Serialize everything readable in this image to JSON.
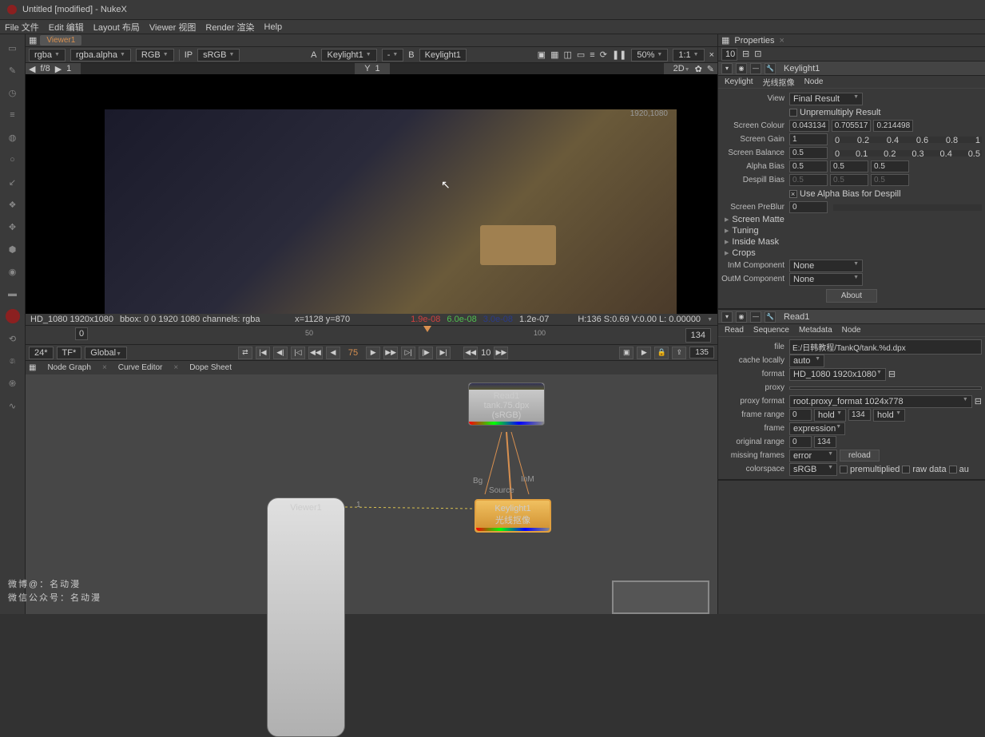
{
  "window": {
    "title": "Untitled [modified] - NukeX"
  },
  "menu": {
    "file": "File 文件",
    "edit": "Edit 编辑",
    "layout": "Layout 布局",
    "viewer": "Viewer 视图",
    "render": "Render 渲染",
    "help": "Help"
  },
  "viewer": {
    "tab": "Viewer1",
    "ch1": "rgba",
    "ch2": "rgba.alpha",
    "ch3": "RGB",
    "ip": "IP",
    "cs": "sRGB",
    "a_label": "A",
    "a_node": "Keylight1",
    "dash": "-",
    "b_label": "B",
    "b_node": "Keylight1",
    "zoom": "50%",
    "ratio": "1:1",
    "fstop": "f/8",
    "gamma": "1",
    "status_format": "HD_1080 1920x1080",
    "status_bbox": "bbox: 0 0 1920 1080 channels: rgba",
    "status_xy": "x=1128 y=870",
    "status_r": "1.9e-08",
    "status_g": "6.0e-08",
    "status_b": "3.0e-08",
    "status_a": "1.2e-07",
    "status_hsv": "H:136 S:0.69 V:0.00  L: 0.00000",
    "res_badge": "1920,1080",
    "mode": "2D"
  },
  "timeline": {
    "start": "0",
    "t50": "50",
    "t100": "100",
    "end": "134",
    "framebox": "134",
    "fps": "24*",
    "tf": "TF*",
    "scope": "Global",
    "cur": "75",
    "skip": "10",
    "endframe": "135"
  },
  "nodegraph": {
    "tab_graph": "Node Graph",
    "tab_curve": "Curve Editor",
    "tab_dope": "Dope Sheet",
    "read_name": "Read1",
    "read_file": "tank.75.dpx",
    "read_cs": "(sRGB)",
    "viewer_name": "Viewer1",
    "key_name": "Keylight1",
    "key_sub": "光线抠像",
    "lbl_bg": "Bg",
    "lbl_src": "Source",
    "lbl_inm": "InM",
    "lbl_one": "1"
  },
  "props": {
    "header": "Properties",
    "count": "10"
  },
  "keylight": {
    "node": "Keylight1",
    "tab_key": "Keylight",
    "tab_cn": "光线抠像",
    "tab_node": "Node",
    "view_lbl": "View",
    "view_val": "Final Result",
    "unpremult": "Unpremultiply Result",
    "sc_lbl": "Screen Colour",
    "sc_r": "0.043134",
    "sc_g": "0.705517",
    "sc_b": "0.214498",
    "gain_lbl": "Screen Gain",
    "gain": "1",
    "bal_lbl": "Screen Balance",
    "bal": "0.5",
    "ab_lbl": "Alpha Bias",
    "ab1": "0.5",
    "ab2": "0.5",
    "ab3": "0.5",
    "db_lbl": "Despill Bias",
    "db1": "0.5",
    "db2": "0.5",
    "db3": "0.5",
    "useab": "Use Alpha Bias for Despill",
    "preblur_lbl": "Screen PreBlur",
    "preblur": "0",
    "exp_matte": "Screen Matte",
    "exp_tuning": "Tuning",
    "exp_inside": "Inside Mask",
    "exp_crops": "Crops",
    "inm_lbl": "InM Component",
    "inm": "None",
    "outm_lbl": "OutM Component",
    "outm": "None",
    "about": "About"
  },
  "read": {
    "node": "Read1",
    "tab_read": "Read",
    "tab_seq": "Sequence",
    "tab_meta": "Metadata",
    "tab_node": "Node",
    "file_lbl": "file",
    "file": "E:/日韩教程/TankQ/tank.%d.dpx",
    "cache_lbl": "cache locally",
    "cache": "auto",
    "format_lbl": "format",
    "format": "HD_1080 1920x1080",
    "proxy_lbl": "proxy",
    "pf_lbl": "proxy format",
    "pf": "root.proxy_format 1024x778",
    "fr_lbl": "frame range",
    "fr_a": "0",
    "fr_b": "134",
    "hold": "hold",
    "frame_lbl": "frame",
    "frame": "expression",
    "or_lbl": "original range",
    "or_a": "0",
    "or_b": "134",
    "mf_lbl": "missing frames",
    "mf": "error",
    "reload": "reload",
    "cs_lbl": "colorspace",
    "cs": "sRGB",
    "premult": "premultiplied",
    "raw": "raw data",
    "au": "au"
  },
  "watermark": {
    "l1": "微博@：名动漫",
    "l2": "微信公众号：名动漫"
  }
}
